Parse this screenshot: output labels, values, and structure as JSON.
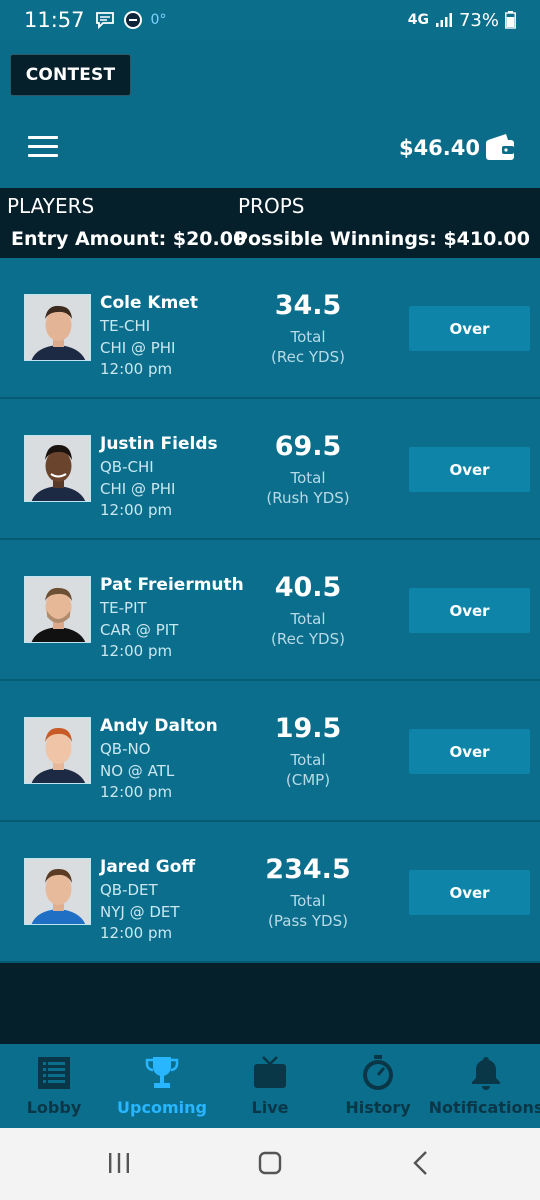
{
  "status_bar": {
    "time": "11:57",
    "temp": "0°",
    "network": "4G",
    "battery": "73%"
  },
  "header": {
    "contest_label": "CONTEST",
    "balance": "$46.40"
  },
  "summary": {
    "players_label": "PLAYERS",
    "props_label": "PROPS",
    "entry_amount": "Entry Amount: $20.00",
    "possible_winnings": "Possible Winnings: $410.00"
  },
  "picks": [
    {
      "name": "Cole Kmet",
      "position": "TE-CHI",
      "matchup": "CHI @ PHI",
      "time": "12:00 pm",
      "line": "34.5",
      "total_label": "Total",
      "stat": "(Rec YDS)",
      "action": "Over"
    },
    {
      "name": "Justin Fields",
      "position": "QB-CHI",
      "matchup": "CHI @ PHI",
      "time": "12:00 pm",
      "line": "69.5",
      "total_label": "Total",
      "stat": "(Rush YDS)",
      "action": "Over"
    },
    {
      "name": "Pat Freiermuth",
      "position": "TE-PIT",
      "matchup": "CAR @ PIT",
      "time": "12:00 pm",
      "line": "40.5",
      "total_label": "Total",
      "stat": "(Rec YDS)",
      "action": "Over"
    },
    {
      "name": "Andy Dalton",
      "position": "QB-NO",
      "matchup": "NO @ ATL",
      "time": "12:00 pm",
      "line": "19.5",
      "total_label": "Total",
      "stat": "(CMP)",
      "action": "Over"
    },
    {
      "name": "Jared Goff",
      "position": "QB-DET",
      "matchup": "NYJ @ DET",
      "time": "12:00 pm",
      "line": "234.5",
      "total_label": "Total",
      "stat": "(Pass YDS)",
      "action": "Over"
    }
  ],
  "bottom_nav": [
    {
      "label": "Lobby",
      "icon": "lobby-list-icon",
      "active": false
    },
    {
      "label": "Upcoming",
      "icon": "trophy-icon",
      "active": true
    },
    {
      "label": "Live",
      "icon": "tv-icon",
      "active": false
    },
    {
      "label": "History",
      "icon": "stopwatch-icon",
      "active": false
    },
    {
      "label": "Notifications",
      "icon": "bell-icon",
      "active": false
    }
  ],
  "colors": {
    "background": "#0b6e8c",
    "dark": "#06202b",
    "button": "#0d84a8",
    "active_nav": "#27b6ff"
  }
}
